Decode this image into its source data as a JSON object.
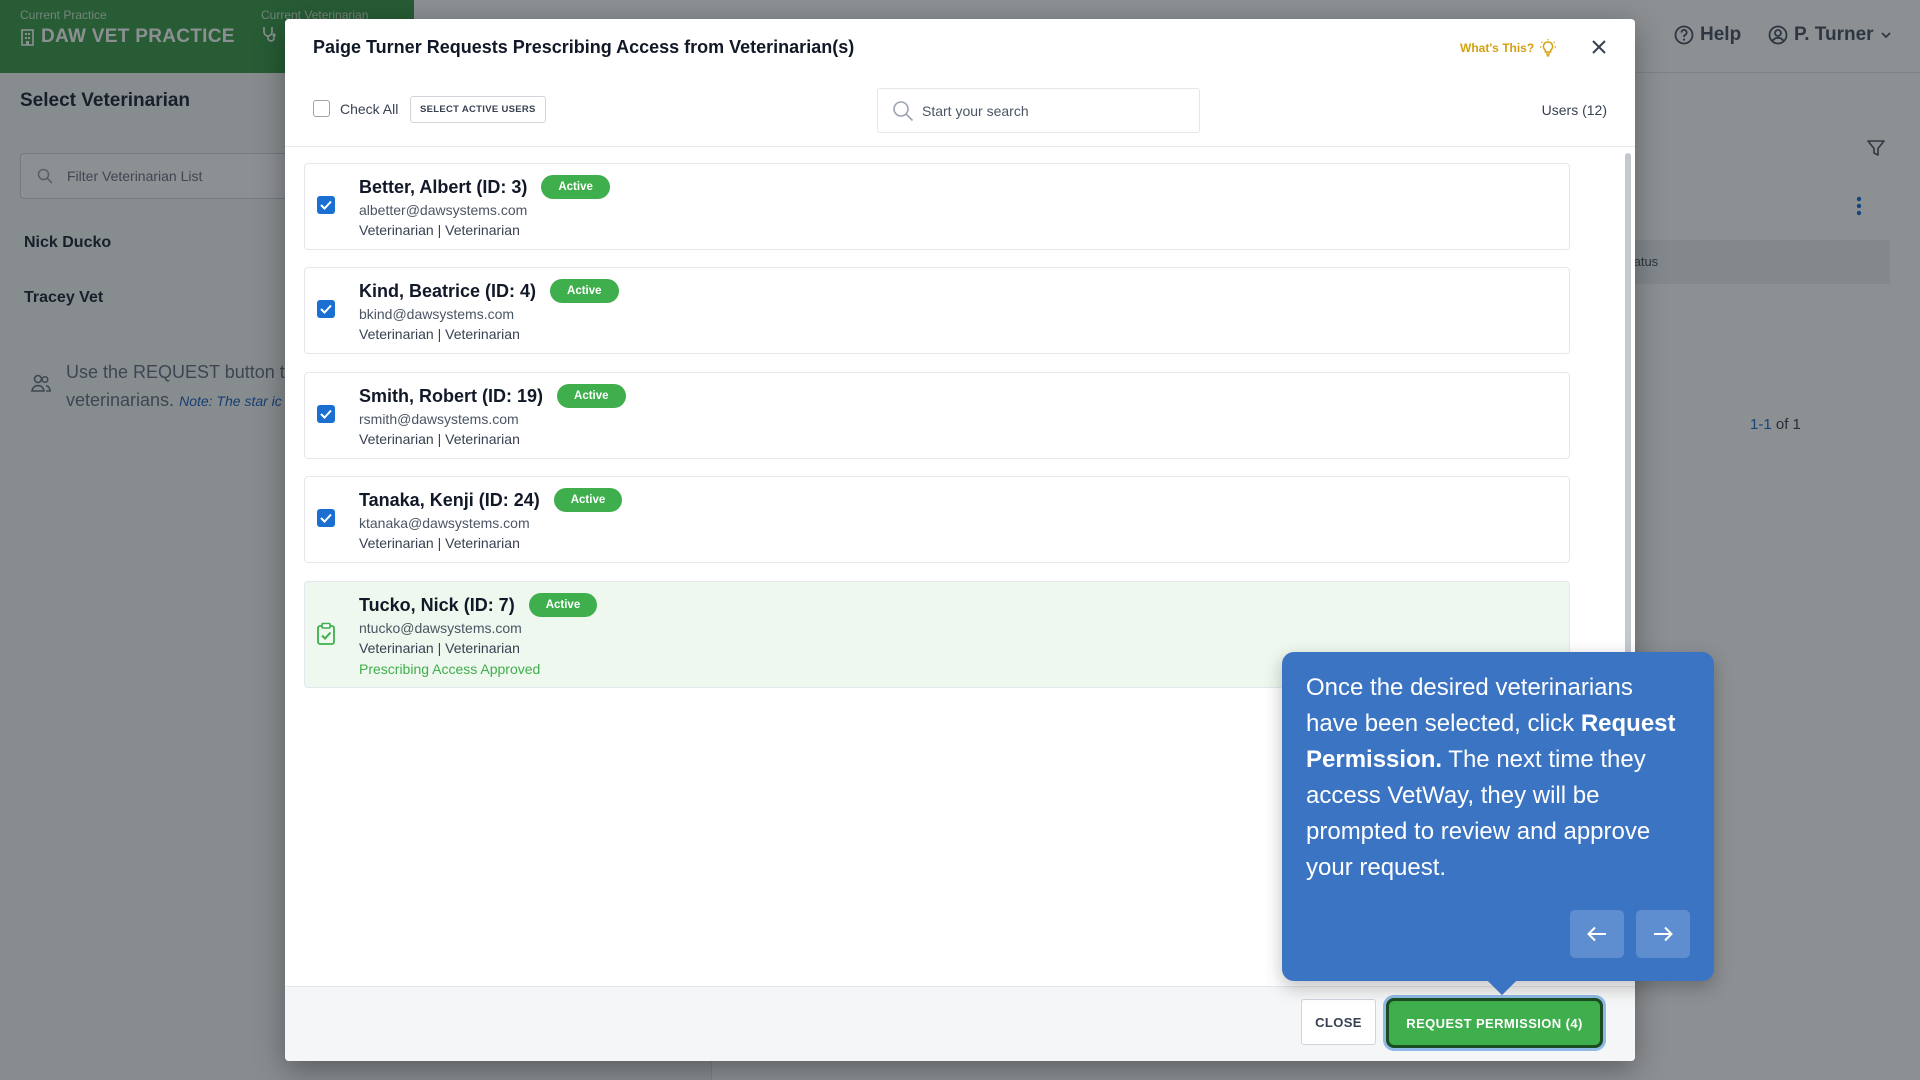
{
  "header": {
    "current_practice_label": "Current Practice",
    "current_practice_value": "DAW VET PRACTICE",
    "current_vet_label": "Current Veterinarian",
    "help_label": "Help",
    "user_label": "P. Turner"
  },
  "sidebar": {
    "title": "Select Veterinarian",
    "filter_placeholder": "Filter Veterinarian List",
    "items": [
      {
        "label": "Nick Ducko"
      },
      {
        "label": "Tracey Vet"
      }
    ],
    "note_text": "Use the REQUEST button t",
    "note_text2": "veterinarians.",
    "note_em": "Note: The star ic"
  },
  "main": {
    "column_header": "tatus",
    "pagination_range": "1-1",
    "pagination_total": "of 1"
  },
  "modal": {
    "title": "Paige Turner Requests Prescribing Access from Veterinarian(s)",
    "whats_this": "What's This?",
    "check_all_label": "Check All",
    "select_active_label": "SELECT ACTIVE USERS",
    "search_placeholder": "Start your search",
    "users_count": "Users (12)",
    "vets": [
      {
        "name": "Better, Albert (ID: 3)",
        "status": "Active",
        "email": "albetter@dawsystems.com",
        "role": "Veterinarian | Veterinarian",
        "checked": true
      },
      {
        "name": "Kind, Beatrice (ID: 4)",
        "status": "Active",
        "email": "bkind@dawsystems.com",
        "role": "Veterinarian | Veterinarian",
        "checked": true
      },
      {
        "name": "Smith, Robert (ID: 19)",
        "status": "Active",
        "email": "rsmith@dawsystems.com",
        "role": "Veterinarian | Veterinarian",
        "checked": true
      },
      {
        "name": "Tanaka, Kenji (ID: 24)",
        "status": "Active",
        "email": "ktanaka@dawsystems.com",
        "role": "Veterinarian | Veterinarian",
        "checked": true
      },
      {
        "name": "Tucko, Nick (ID: 7)",
        "status": "Active",
        "email": "ntucko@dawsystems.com",
        "role": "Veterinarian | Veterinarian",
        "approved_text": "Prescribing Access Approved"
      }
    ],
    "close_label": "CLOSE",
    "request_label": "REQUEST PERMISSION (4)"
  },
  "tooltip": {
    "text_before": "Once the desired veterinarians have been selected, click ",
    "text_bold": "Request Permission.",
    "text_after": " The next time they access VetWay, they will be prompted to review and approve your request."
  },
  "colors": {
    "brand_green": "#3fae4c",
    "practice_green": "#3f9b4b",
    "tooltip_blue": "#3b74c2",
    "checkbox_blue": "#1a6fd1",
    "whats_this_gold": "#d4a00f"
  },
  "icons": [
    "building-icon",
    "stethoscope-icon",
    "help-circle-icon",
    "user-circle-icon",
    "chevron-down-icon",
    "search-icon",
    "users-icon",
    "filter-icon",
    "kebab-icon",
    "lightbulb-icon",
    "close-icon",
    "check-icon",
    "clipboard-check-icon",
    "arrow-left-icon",
    "arrow-right-icon"
  ]
}
